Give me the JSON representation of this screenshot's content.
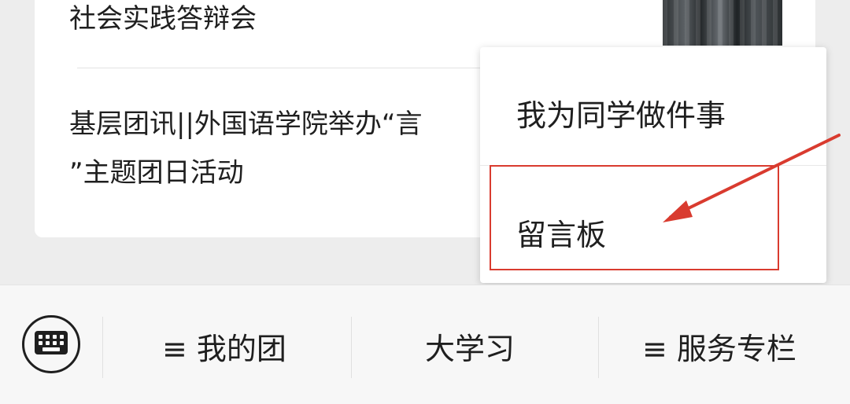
{
  "feed": {
    "articles": [
      {
        "title": "社会实践答辩会"
      },
      {
        "title_line1": "基层团讯||外国语学院举办“言",
        "title_line2": "”主题团日活动"
      }
    ]
  },
  "popup_menu": {
    "items": [
      {
        "label": "我为同学做件事"
      },
      {
        "label": "留言板"
      }
    ],
    "highlight_color": "#d93b2f"
  },
  "bottom_bar": {
    "items": [
      {
        "label": "≡ 我的团"
      },
      {
        "label": "大学习"
      },
      {
        "label": "≡ 服务专栏"
      }
    ]
  }
}
